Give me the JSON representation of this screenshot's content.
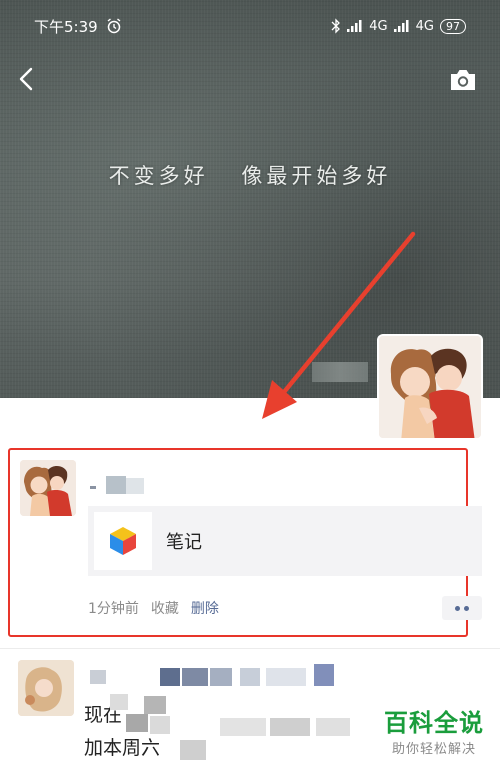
{
  "status_bar": {
    "time": "下午5:39",
    "network_1": "4G",
    "network_2": "4G",
    "battery": "97"
  },
  "cover": {
    "text": "不变多好 像最开始多好"
  },
  "post": {
    "link_card_title": "笔记",
    "time_ago": "1分钟前",
    "favorite_label": "收藏",
    "delete_label": "删除"
  },
  "post2": {
    "text_line_1": "现在",
    "text_line_2": "加本周六"
  },
  "watermark": {
    "brand": "百科全说",
    "slogan": "助你轻松解决"
  },
  "colors": {
    "highlight_border": "#e8352a",
    "arrow": "#e8402e",
    "link_blue": "#576b95",
    "watermark_green": "#1a9d3c"
  },
  "icons": {
    "back": "back-arrow-icon",
    "camera": "camera-icon",
    "alarm": "alarm-icon",
    "bluetooth": "bluetooth-icon",
    "note_app": "note-cube-icon"
  }
}
